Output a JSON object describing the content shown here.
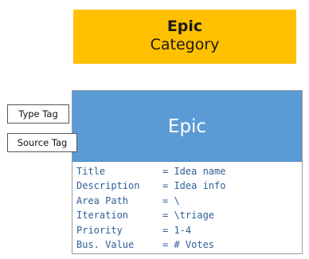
{
  "category": {
    "title": "Epic",
    "subtitle": "Category"
  },
  "card": {
    "title": "Epic",
    "fields": [
      {
        "label": "Title",
        "value": "= Idea name"
      },
      {
        "label": "Description",
        "value": "= Idea info"
      },
      {
        "label": "Area Path",
        "value": "= \\"
      },
      {
        "label": "Iteration",
        "value": "= \\triage"
      },
      {
        "label": "Priority",
        "value": "= 1-4"
      },
      {
        "label": "Bus. Value",
        "value": "= # Votes"
      }
    ]
  },
  "tags": {
    "type_label": "Type Tag",
    "source_label": "Source Tag"
  },
  "colors": {
    "category_banner": "#FFC000",
    "card_header": "#5B9BD5",
    "field_text": "#2F5F99"
  }
}
